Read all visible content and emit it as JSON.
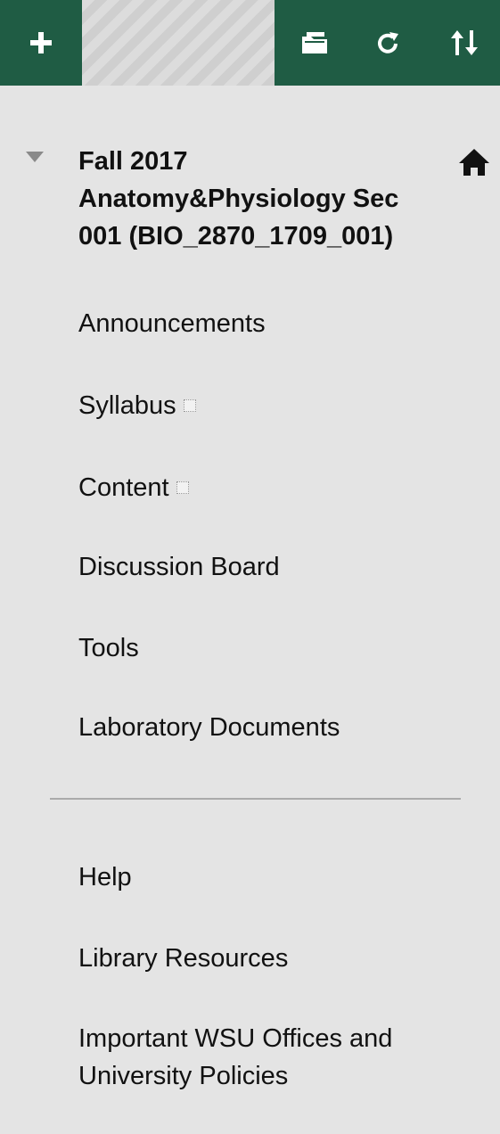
{
  "toolbar": {
    "add_icon": "plus-icon",
    "folder_icon": "folder-icon",
    "refresh_icon": "refresh-icon",
    "sort_icon": "sort-icon",
    "color": "#1f5c44"
  },
  "course": {
    "title": "Fall 2017\nAnatomy&Physiology Sec\n001 (BIO_2870_1709_001)",
    "collapse_icon": "triangle-down-icon",
    "home_icon": "home-icon"
  },
  "menu": {
    "announcements": "Announcements",
    "syllabus": "Syllabus",
    "content": "Content",
    "discussion_board": "Discussion Board",
    "tools": "Tools",
    "laboratory_documents": "Laboratory Documents",
    "help": "Help",
    "library_resources": "Library Resources",
    "important_offices": "Important WSU Offices and University Policies"
  }
}
